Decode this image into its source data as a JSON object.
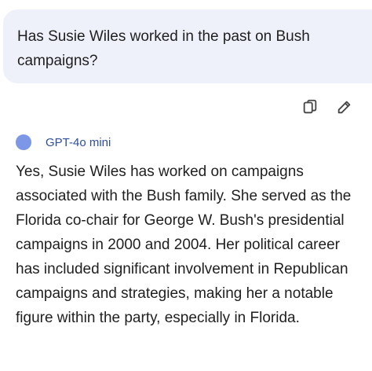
{
  "user_message": {
    "text": "Has Susie Wiles worked in the past on Bush campaigns?"
  },
  "actions": {
    "copy_icon": "copy-icon",
    "edit_icon": "edit-pencil-icon"
  },
  "response": {
    "model_name": "GPT-4o mini",
    "text": "Yes, Susie Wiles has worked on campaigns associated with the Bush family. She served as the Florida co-chair for George W. Bush's presidential campaigns in 2000 and 2004. Her political career has included significant involvement in Republican campaigns and strategies, making her a notable figure within the party, especially in Florida."
  },
  "colors": {
    "user_bubble_bg": "#eef1fa",
    "model_dot": "#7b97e6",
    "model_name": "#2d4f9e",
    "text": "#1f1f1f",
    "icon": "#444746"
  }
}
